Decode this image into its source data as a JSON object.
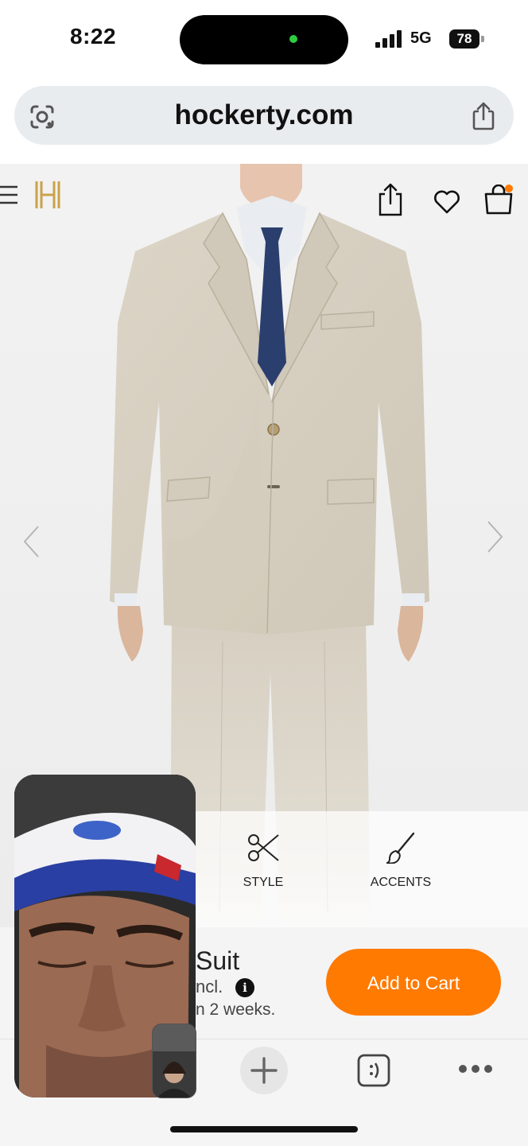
{
  "status_bar": {
    "time": "8:22",
    "network": "5G",
    "battery": "78"
  },
  "browser": {
    "url": "hockerty.com"
  },
  "icons": {
    "lens": "google-lens-icon",
    "share_url": "share-icon",
    "menu": "hamburger-icon",
    "logo": "hockerty-h-logo-icon",
    "share_page": "share-icon",
    "wishlist": "heart-icon",
    "cart": "shopping-bag-icon",
    "prev": "chevron-left-icon",
    "next": "chevron-right-icon",
    "style": "scissors-icon",
    "accents": "brush-icon",
    "new_tab": "plus-icon",
    "tabs": "tabs-icon",
    "more": "more-icon"
  },
  "customize": {
    "style_label": "STYLE",
    "accents_label": "ACCENTS"
  },
  "product": {
    "name": "Suit",
    "price_note": "ncl.",
    "delivery_note": "n 2 weeks.",
    "add_to_cart": "Add to Cart"
  },
  "colors": {
    "accent": "#ff7a00",
    "logo": "#c9a24a",
    "suit": "#d9d2c4",
    "tie": "#2b3f6e"
  }
}
